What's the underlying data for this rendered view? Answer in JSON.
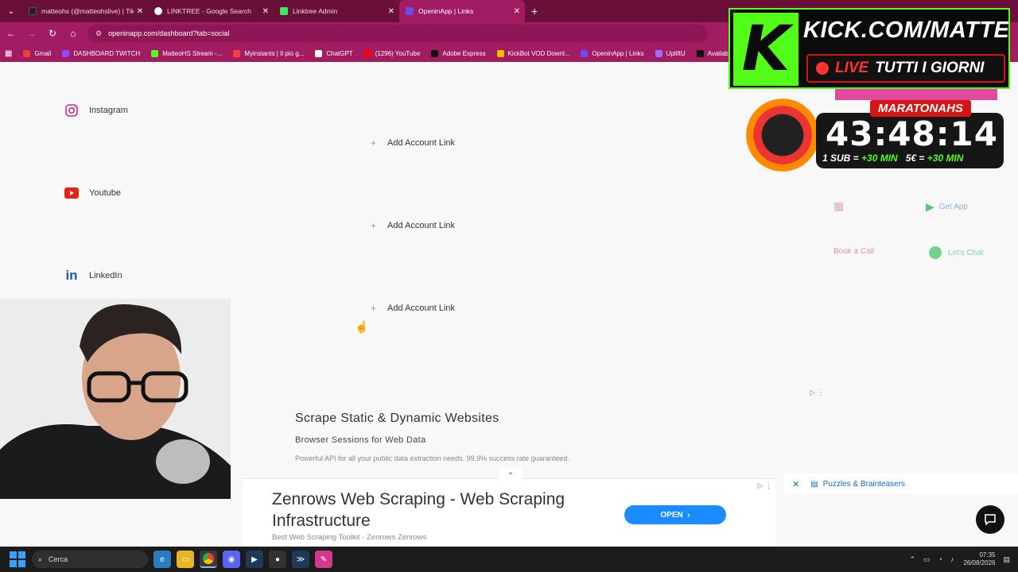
{
  "browser": {
    "tabs": [
      {
        "title": "matteohs (@matteohslive) | Tik",
        "active": false,
        "icon_color": "#222222"
      },
      {
        "title": "LINKTREE - Google Search",
        "active": false,
        "icon_color": "#ffffff"
      },
      {
        "title": "Linktree Admin",
        "active": false,
        "icon_color": "#43e660"
      },
      {
        "title": "OpeninApp | Links",
        "active": true,
        "icon_color": "#6c4cf1"
      }
    ],
    "url": "openinapp.com/dashboard?tab=social",
    "bookmarks": [
      {
        "label": "Gmail",
        "color": "#ea4335"
      },
      {
        "label": "DASHBOARD TWITCH",
        "color": "#9146ff"
      },
      {
        "label": "MatteoHS Stream -...",
        "color": "#53fc18"
      },
      {
        "label": "Myinstants | Il più g...",
        "color": "#ff3d3d"
      },
      {
        "label": "ChatGPT",
        "color": "#ffffff"
      },
      {
        "label": "(1296) YouTube",
        "color": "#ff0000"
      },
      {
        "label": "Adobe Express",
        "color": "#111111"
      },
      {
        "label": "KickBot VOD Downl...",
        "color": "#f0c000"
      },
      {
        "label": "OpeninApp | Links",
        "color": "#6c4cf1"
      },
      {
        "label": "UpliftU",
        "color": "#9c6bff"
      },
      {
        "label": "Available spon",
        "color": "#111111"
      }
    ]
  },
  "page": {
    "socials": [
      {
        "name": "Instagram",
        "icon": "instagram-icon"
      },
      {
        "name": "Youtube",
        "icon": "youtube-icon"
      },
      {
        "name": "LinkedIn",
        "icon": "linkedin-icon"
      }
    ],
    "add_link_label": "Add Account Link",
    "widgets": {
      "book_a_call": "Book a Call",
      "get_app": "Get App",
      "lets_chat": "Let's Chat"
    },
    "ad": {
      "title": "Scrape Static & Dynamic Websites",
      "subtitle": "Browser Sessions for Web Data",
      "description": "Powerful API for all your public data extraction needs. 99.9% success rate guaranteed."
    },
    "banner_ad": {
      "title": "Zenrows Web Scraping - Web Scraping Infrastructure",
      "source": "Best Web Scraping Toolkit - Zenrows Zenrows",
      "button": "OPEN"
    },
    "puzzles": "Puzzles & Brainteasers"
  },
  "overlay": {
    "kick_url": "KICK.COM/MATTEOHS",
    "live_word": "LIVE",
    "live_rest": "TUTTI I GIORNI",
    "timer_title": "MARATONAHS",
    "timer_value": "43:48:14",
    "rule_sub": "1 SUB =",
    "rule_sub_val": "+30 MIN",
    "rule_eur": "5€ =",
    "rule_eur_val": "+30 MIN"
  },
  "taskbar": {
    "search_placeholder": "Cerca",
    "time": "07:35",
    "date": "26/08/2026"
  }
}
